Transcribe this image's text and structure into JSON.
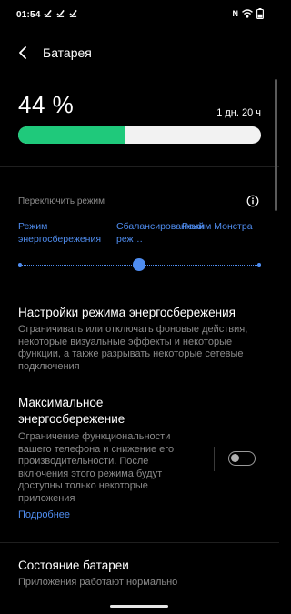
{
  "status_bar": {
    "time": "01:54",
    "nfc_letter": "N",
    "left_icons": [
      "check-icon",
      "check-icon",
      "check-icon"
    ],
    "right_icons": [
      "nfc-icon",
      "wifi-icon",
      "battery-icon"
    ]
  },
  "header": {
    "title": "Батарея",
    "back_icon": "back-arrow-icon"
  },
  "battery": {
    "percent_label": "44 %",
    "level": 0.44,
    "remaining": "1 дн. 20 ч",
    "fill_color": "#1fc97b"
  },
  "mode_switch": {
    "label": "Переключить режим",
    "info_icon": "info-icon",
    "options": [
      "Режим энергосбережения",
      "Сбалансированный реж…",
      "Режим Монстра"
    ],
    "selected_index": 1,
    "accent_color": "#4f8df0"
  },
  "power_saving_settings": {
    "title": "Настройки режима энергосбережения",
    "description": "Ограничивать или отключать фоновые действия, некоторые визуальные эффекты и некоторые функции, а также разрывать некоторые сетевые подключения"
  },
  "max_power_saving": {
    "title": "Максимальное энергосбережение",
    "description": "Ограничение функциональности вашего телефона и снижение его производительности. После включения этого режима будут доступны только некоторые приложения",
    "learn_more": "Подробнее",
    "enabled": false
  },
  "battery_health": {
    "title": "Состояние батареи",
    "description": "Приложения работают нормально"
  }
}
